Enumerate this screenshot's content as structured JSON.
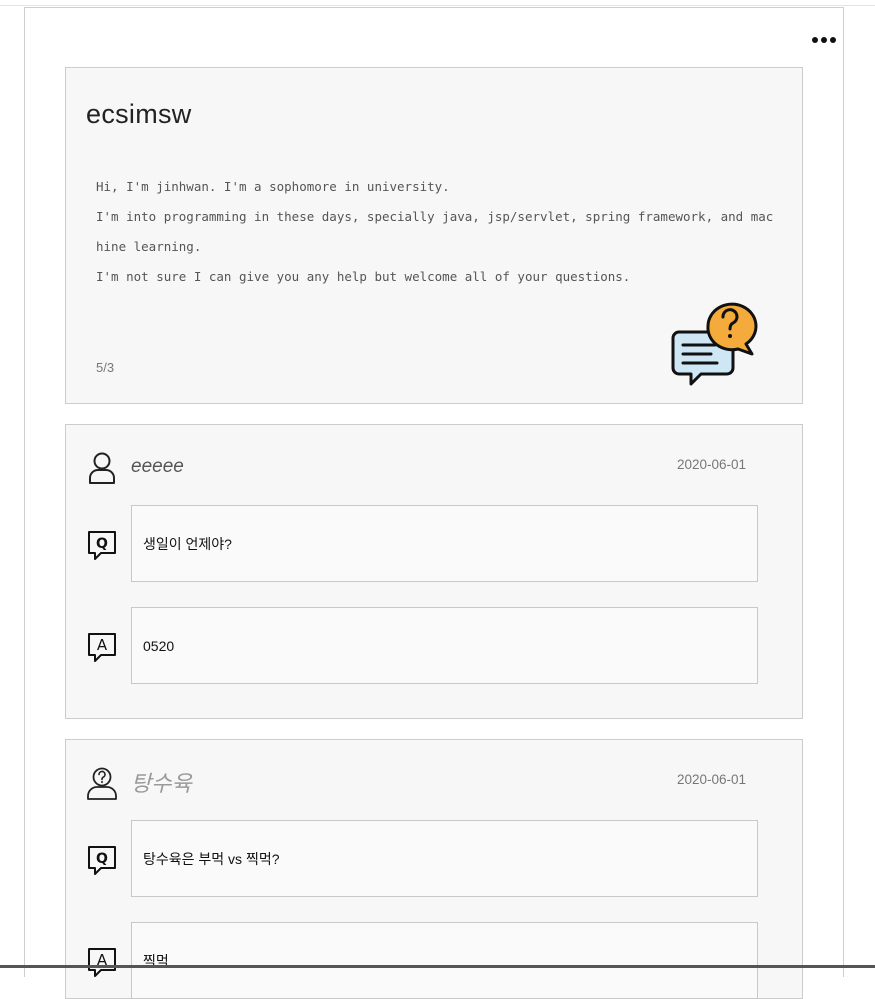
{
  "profile": {
    "name": "ecsimsw",
    "intro_lines": [
      "Hi, I'm jinhwan. I'm a sophomore in university.",
      "I'm into programming in these days, specially java, jsp/servlet, spring framework, and machine learning.",
      "I'm not sure I can give you any help but welcome all of your questions."
    ],
    "count": "5/3"
  },
  "questions": [
    {
      "asker": "eeeee",
      "date": "2020-06-01",
      "question": "생일이 언제야?",
      "answer": "0520",
      "avatar": "user-icon"
    },
    {
      "asker": "탕수육",
      "date": "2020-06-01",
      "question": "탕수육은 부먹 vs 찍먹?",
      "answer": "찍먹",
      "avatar": "anonymous-user-icon"
    }
  ],
  "icons": {
    "more": "more-options-icon",
    "question": "question-q-icon",
    "answer": "answer-a-icon",
    "illustration": "qa-chat-bubbles-icon"
  },
  "colors": {
    "card_bg": "#f7f7f7",
    "border": "#cccccc",
    "bubble_orange": "#f4ab3c",
    "bubble_blue": "#cfe7f5"
  }
}
